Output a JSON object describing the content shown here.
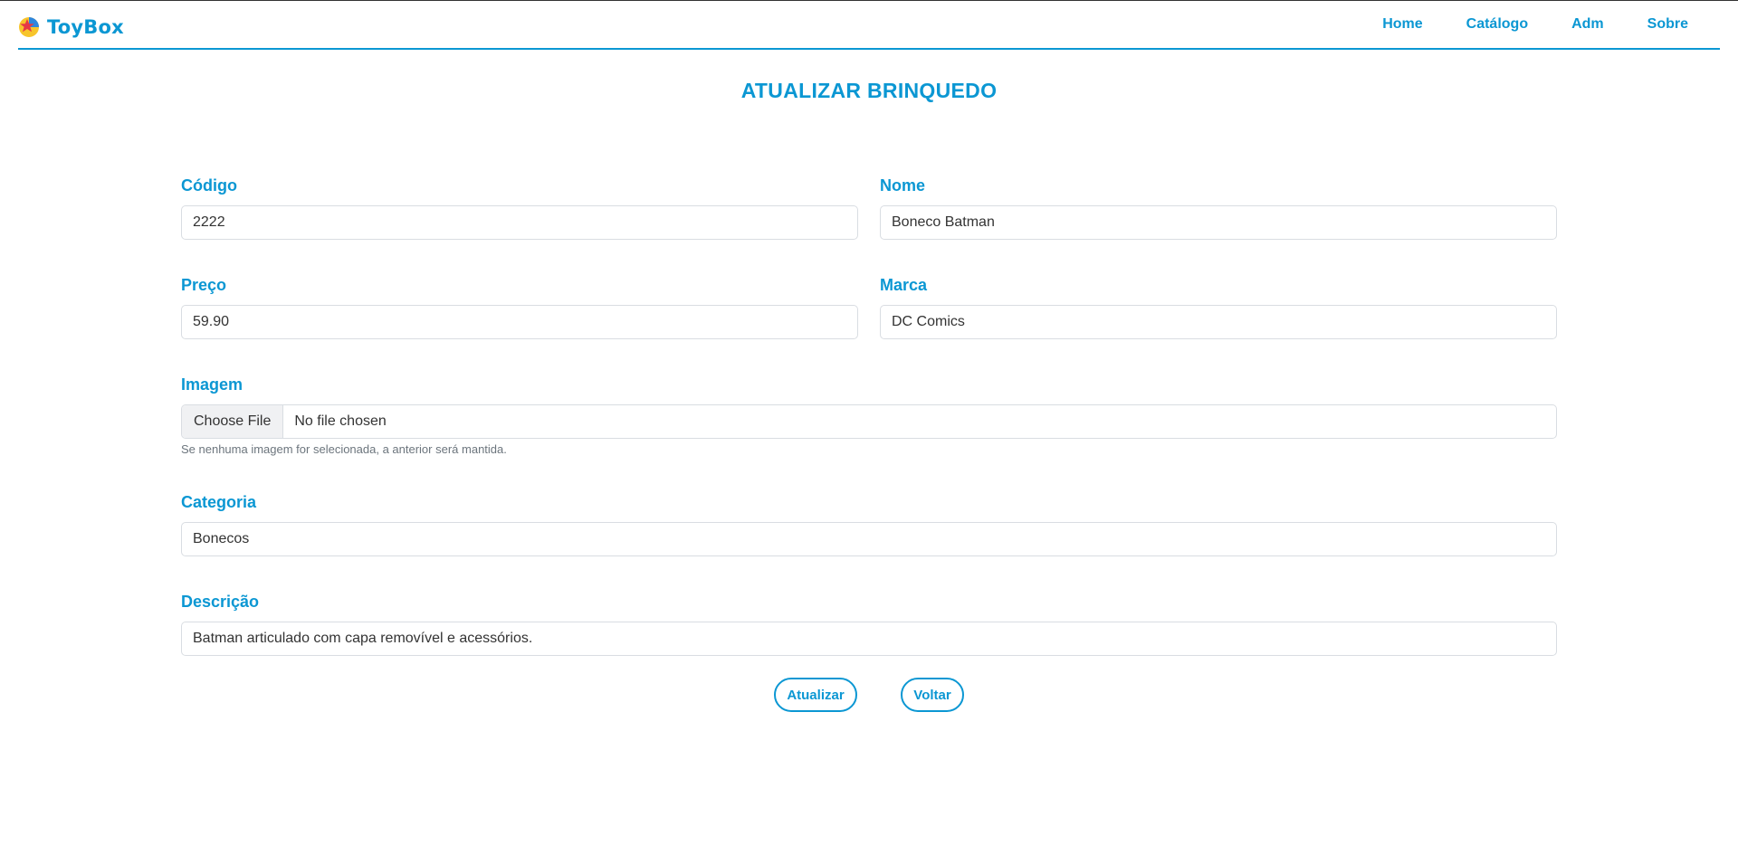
{
  "navbar": {
    "brand": "ToyBox",
    "links": [
      "Home",
      "Catálogo",
      "Adm",
      "Sobre"
    ]
  },
  "page_title": "ATUALIZAR BRINQUEDO",
  "form": {
    "codigo": {
      "label": "Código",
      "value": "2222"
    },
    "nome": {
      "label": "Nome",
      "value": "Boneco Batman"
    },
    "preco": {
      "label": "Preço",
      "value": "59.90"
    },
    "marca": {
      "label": "Marca",
      "value": "DC Comics"
    },
    "imagem": {
      "label": "Imagem",
      "button": "Choose File",
      "status": "No file chosen",
      "help": "Se nenhuma imagem for selecionada, a anterior será mantida."
    },
    "categoria": {
      "label": "Categoria",
      "value": "Bonecos"
    },
    "descricao": {
      "label": "Descrição",
      "value": "Batman articulado com capa removível e acessórios."
    }
  },
  "buttons": {
    "update": "Atualizar",
    "back": "Voltar"
  },
  "colors": {
    "accent": "#0b97d3",
    "border": "#d9dde2",
    "logo_red": "#e63946",
    "logo_yellow": "#f7c52b"
  },
  "icons": {
    "logo": "star-ball-logo-icon"
  }
}
